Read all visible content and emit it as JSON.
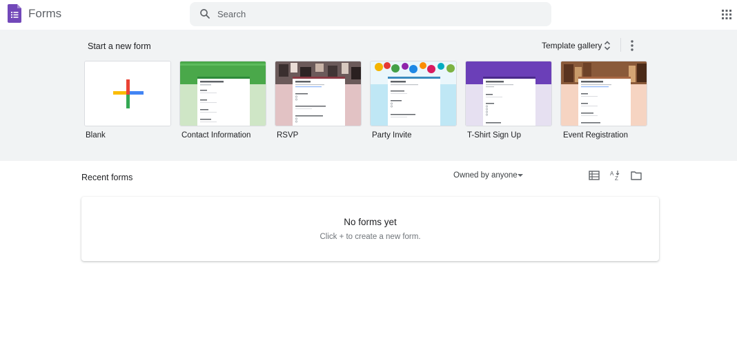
{
  "header": {
    "app_title": "Forms",
    "search_placeholder": "Search",
    "colors": {
      "logo": "#7248b9",
      "search_bg": "#f1f3f4"
    }
  },
  "templates": {
    "section_title": "Start a new form",
    "gallery_label": "Template gallery",
    "items": [
      {
        "label": "Blank"
      },
      {
        "label": "Contact Information"
      },
      {
        "label": "RSVP"
      },
      {
        "label": "Party Invite"
      },
      {
        "label": "T-Shirt Sign Up"
      },
      {
        "label": "Event Registration"
      }
    ]
  },
  "recent": {
    "title": "Recent forms",
    "owner_filter": "Owned by anyone",
    "empty_title": "No forms yet",
    "empty_subtitle": "Click + to create a new form."
  }
}
